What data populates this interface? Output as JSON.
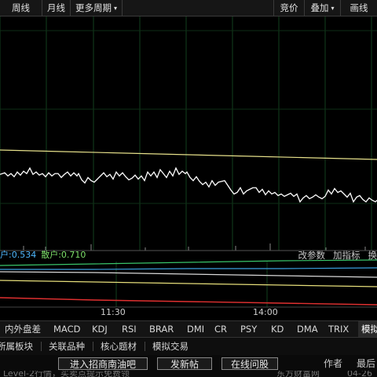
{
  "toolbar": {
    "left": [
      {
        "label": "周线"
      },
      {
        "label": "月线"
      },
      {
        "label": "更多周期",
        "caret": "▾"
      }
    ],
    "right": [
      {
        "label": "竞价"
      },
      {
        "label": "叠加",
        "caret": "▾"
      },
      {
        "label": "画线"
      }
    ]
  },
  "indicator": {
    "values": [
      {
        "label": "户:0.534",
        "color": "#4fb8ff"
      },
      {
        "label": "散户:0.710",
        "color": "#7ee06a"
      }
    ],
    "links": [
      "改参数",
      "加指标",
      "换"
    ]
  },
  "time_axis": [
    "11:30",
    "14:00"
  ],
  "indicator_tabs": [
    "内外盘差",
    "MACD",
    "KDJ",
    "RSI",
    "BRAR",
    "DMI",
    "CR",
    "PSY",
    "KD",
    "DMA",
    "TRIX",
    "模拟"
  ],
  "active_tab": "模拟",
  "sub_menu": [
    "所属板块",
    "关联品种",
    "核心题材",
    "模拟交易"
  ],
  "bottom": {
    "btn_chat": "进入招商南油吧",
    "btn_post": "发新帖",
    "btn_ask": "在线问股",
    "author": "作者",
    "latest": "最后"
  },
  "ticker": {
    "left": "Level-2行情，买卖点提示免费领",
    "right": "东方财富网",
    "date": "04-26"
  },
  "colors": {
    "price_line": "#ffffff",
    "avg_line": "#e6e08a",
    "grid": "#123f1e",
    "green_line": "#39c46a",
    "blue_line": "#3aa0e0",
    "white_line": "#d8d8d8",
    "yellow_line": "#e6de7a",
    "red_line": "#e03030"
  }
}
